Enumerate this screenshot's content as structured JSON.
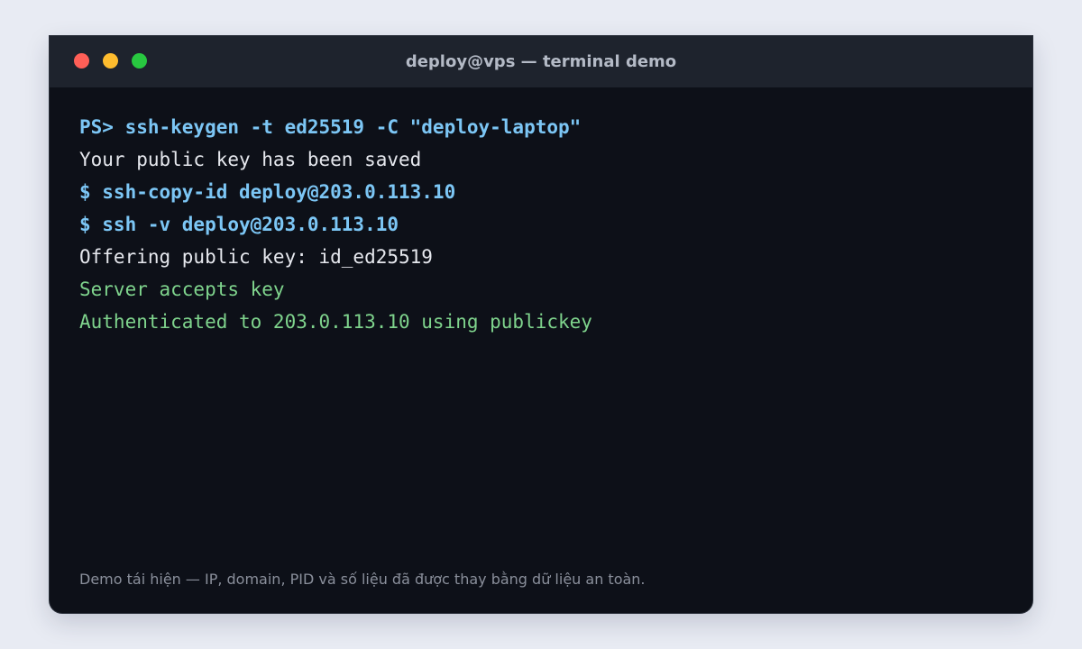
{
  "window": {
    "title": "deploy@vps — terminal demo",
    "controls": [
      {
        "name": "close",
        "color": "#ff5f57"
      },
      {
        "name": "minimize",
        "color": "#febc2e"
      },
      {
        "name": "maximize",
        "color": "#28c840"
      }
    ]
  },
  "terminal": {
    "lines": [
      {
        "kind": "command",
        "text": "PS> ssh-keygen -t ed25519 -C \"deploy-laptop\""
      },
      {
        "kind": "output",
        "text": "Your public key has been saved"
      },
      {
        "kind": "command",
        "text": "$ ssh-copy-id deploy@203.0.113.10"
      },
      {
        "kind": "command",
        "text": "$ ssh -v deploy@203.0.113.10"
      },
      {
        "kind": "output",
        "text": "Offering public key: id_ed25519"
      },
      {
        "kind": "success",
        "text": "Server accepts key"
      },
      {
        "kind": "success",
        "text": "Authenticated to 203.0.113.10 using publickey"
      }
    ]
  },
  "footnote": "Demo tái hiện — IP, domain, PID và số liệu đã được thay bằng dữ liệu an toàn.",
  "colors": {
    "page_background": "#e8ebf3",
    "terminal_background": "#0d1018",
    "titlebar_background": "#1e232d",
    "command_text": "#7cc6f5",
    "output_text": "#e6e8ee",
    "success_text": "#7fd48d",
    "footnote_text": "#8a8f9b"
  }
}
